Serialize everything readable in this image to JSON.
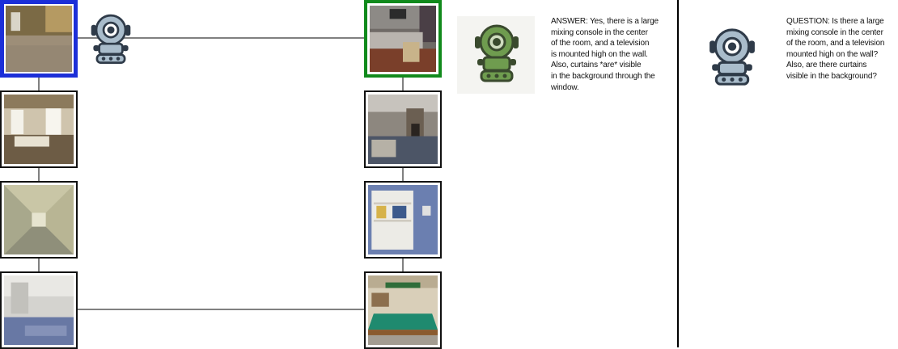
{
  "colors": {
    "start_border": "#1c2fd8",
    "target_border": "#118a1c",
    "connector": "#808080",
    "divider": "#000000"
  },
  "answer_panel": {
    "robot_icon": "green-robot-icon",
    "text": "ANSWER: Yes, there is a large\nmixing console in the center\nof the room, and a television\nis mounted high on the wall.\nAlso, curtains *are* visible\nin the background through the\nwindow."
  },
  "question_panel": {
    "robot_icon": "blue-robot-icon",
    "text": "QUESTION: Is there a large\nmixing console in the center\nof the room, and a television\nmounted high on the wall?\nAlso, are there curtains\nvisible in the background?"
  }
}
